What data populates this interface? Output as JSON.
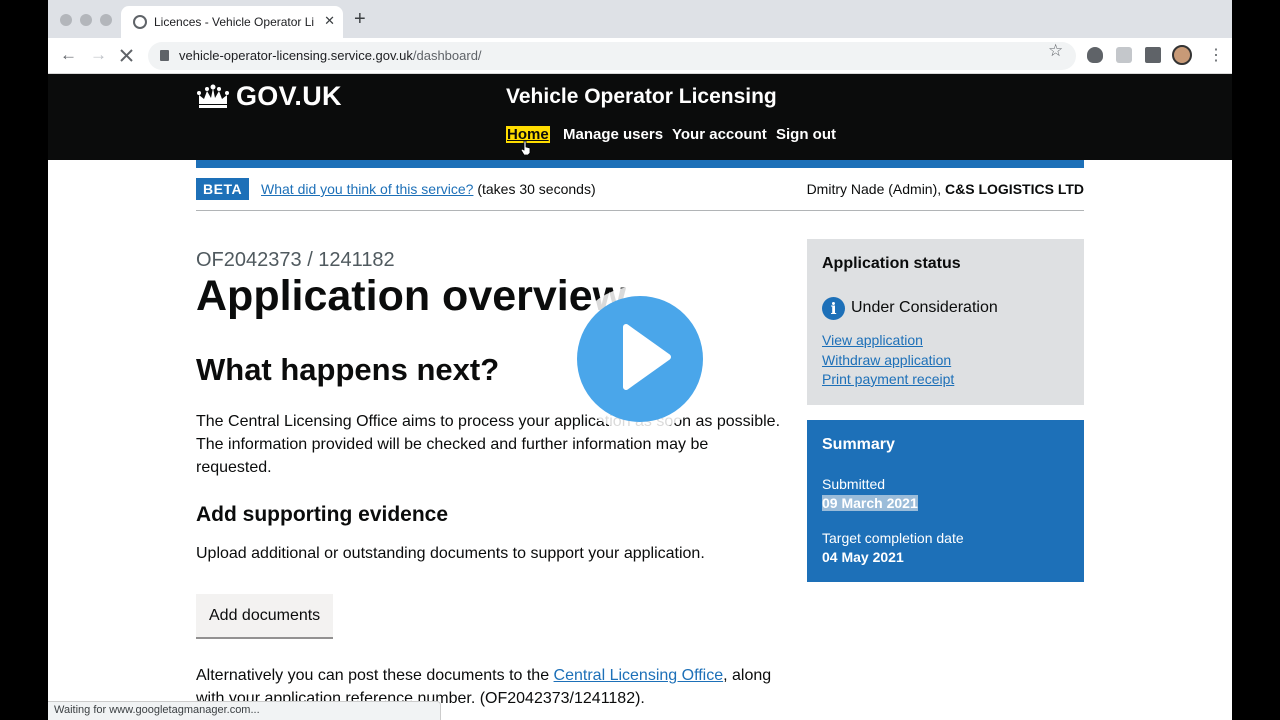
{
  "browser": {
    "tab_title": "Licences - Vehicle Operator Licensing",
    "new_tab": "+",
    "tab_close": "✕",
    "url_domain": "vehicle-operator-licensing.service.gov.uk",
    "url_path": "/dashboard/",
    "status": "Waiting for www.googletagmanager.com..."
  },
  "header": {
    "logo": "GOV.UK",
    "service_name": "Vehicle Operator Licensing",
    "nav": [
      "Home",
      "Manage users",
      "Your account",
      "Sign out"
    ]
  },
  "phase_banner": {
    "tag": "BETA",
    "link": "What did you think of this service?",
    "suffix": " (takes 30 seconds)",
    "user": "Dmitry Nade (Admin), ",
    "organisation": "C&S LOGISTICS LTD"
  },
  "main": {
    "caption": "OF2042373 / 1241182",
    "title": "Application overview",
    "next_heading": "What happens next?",
    "next_text": "The Central Licensing Office aims to process your application as soon as possible. The information provided will be checked and further information may be requested.",
    "evidence_heading": "Add supporting evidence",
    "evidence_text": "Upload additional or outstanding documents to support your application.",
    "add_button": "Add documents",
    "post_text_1": "Alternatively you can post these documents to the ",
    "post_link": "Central Licensing Office",
    "post_text_2": ", along with your application reference number. (OF2042373/1241182)."
  },
  "status_panel": {
    "title": "Application status",
    "info_glyph": "i",
    "status": "Under Consideration",
    "links": [
      "View application",
      "Withdraw application",
      "Print payment receipt"
    ]
  },
  "summary_panel": {
    "title": "Summary",
    "submitted_label": "Submitted",
    "submitted_value": "09 March 2021",
    "target_label": "Target completion date",
    "target_value": "04 May 2021"
  }
}
